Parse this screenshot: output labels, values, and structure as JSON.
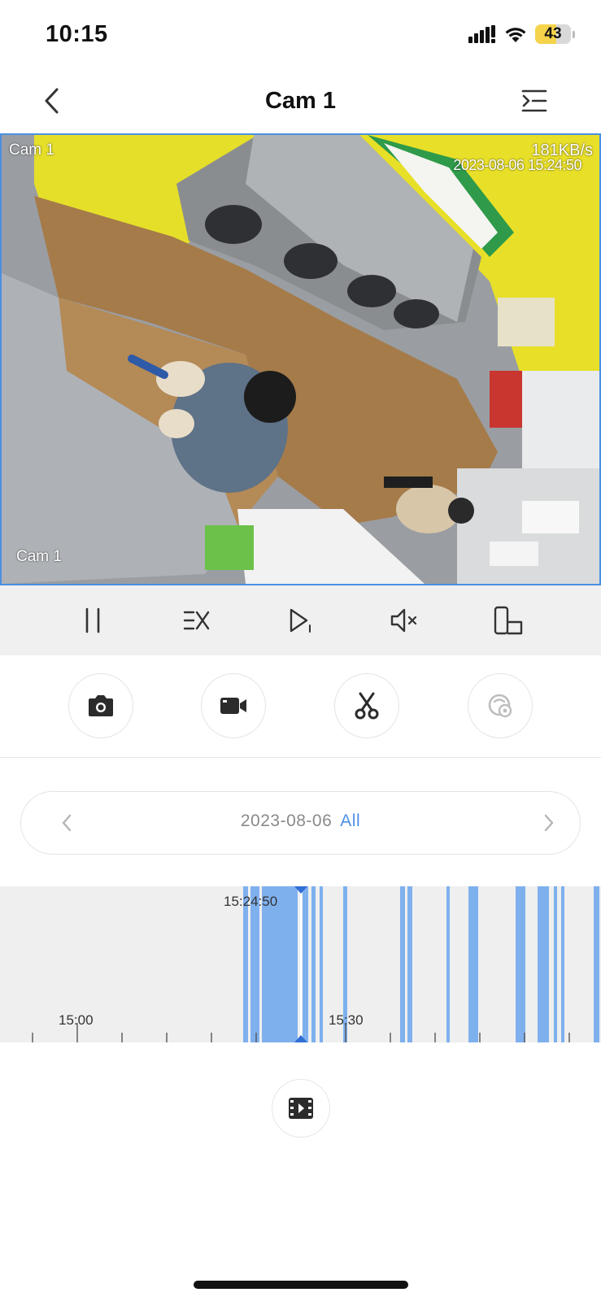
{
  "status_bar": {
    "time": "10:15",
    "battery_level": "43",
    "icons": [
      "cellular-signal-icon",
      "wifi-icon",
      "battery-icon"
    ]
  },
  "nav": {
    "title": "Cam 1",
    "back_icon": "chevron-left-icon",
    "menu_icon": "menu-collapse-icon"
  },
  "video": {
    "camera_label": "Cam 1",
    "bitrate": "181KB/s",
    "timestamp": "2023-08-06 15:24:50",
    "camera_label_bottom": "Cam 1"
  },
  "controls": [
    "pause-icon",
    "playback-speed-icon",
    "play-step-icon",
    "mute-icon",
    "rotate-screen-icon"
  ],
  "actions": [
    "camera-icon",
    "video-record-icon",
    "scissors-icon",
    "face-detect-icon"
  ],
  "date_selector": {
    "date": "2023-08-06",
    "filter": "All"
  },
  "timeline": {
    "cursor_time": "15:24:50",
    "ticks": [
      {
        "label": "15:00"
      },
      {
        "label": "15:30"
      }
    ]
  },
  "bottom": {
    "playlist_icon": "film-play-icon"
  },
  "colors": {
    "accent": "#4f8fe6",
    "timeline_segment": "#7fb0ee",
    "bg": "#ffffff",
    "controls_bg": "#f0f0f0"
  }
}
